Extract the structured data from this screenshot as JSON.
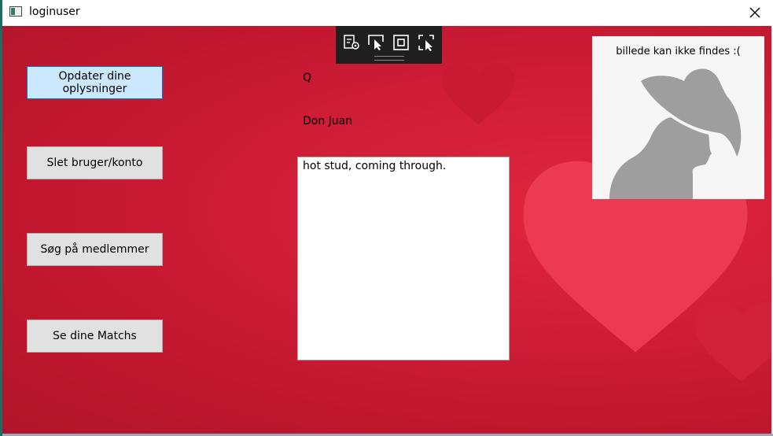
{
  "window": {
    "title": "loginuser",
    "close_glyph": "✕"
  },
  "sidebar": {
    "buttons": [
      {
        "label": "Opdater dine oplysninger"
      },
      {
        "label": "Slet bruger/konto"
      },
      {
        "label": "Søg på medlemmer"
      },
      {
        "label": "Se dine Matchs"
      }
    ]
  },
  "profile": {
    "username": "Q",
    "display_name": "Don Juan",
    "description": "hot stud, coming through.",
    "picture_caption": "billede kan ikke findes :("
  },
  "debug_toolbar": {
    "icons": [
      "live-visual-tree-icon",
      "select-element-icon",
      "display-layout-adorners-icon",
      "track-focused-element-icon"
    ]
  },
  "colors": {
    "background": "#d21e38",
    "button_focused": "#cce8ff",
    "button_default": "#e1e1e1"
  }
}
